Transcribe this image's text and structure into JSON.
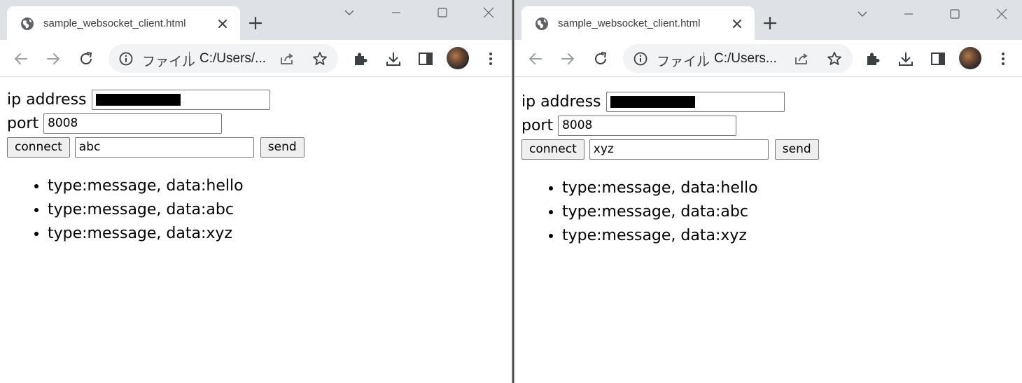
{
  "windows": [
    {
      "tab_title": "sample_websocket_client.html",
      "omnibox": {
        "scheme_label": "ファイル",
        "url": "C:/Users/..."
      },
      "form": {
        "ip_label": "ip address",
        "ip_value": "",
        "port_label": "port",
        "port_value": "8008",
        "connect_label": "connect",
        "message_value": "abc",
        "send_label": "send"
      },
      "messages": [
        "type:message, data:hello",
        "type:message, data:abc",
        "type:message, data:xyz"
      ]
    },
    {
      "tab_title": "sample_websocket_client.html",
      "omnibox": {
        "scheme_label": "ファイル",
        "url": "C:/Users..."
      },
      "form": {
        "ip_label": "ip address",
        "ip_value": "",
        "port_label": "port",
        "port_value": "8008",
        "connect_label": "connect",
        "message_value": "xyz",
        "send_label": "send"
      },
      "messages": [
        "type:message, data:hello",
        "type:message, data:abc",
        "type:message, data:xyz"
      ]
    }
  ],
  "icons": {
    "tab": [
      "globe-icon",
      "close-icon",
      "new-tab-icon"
    ],
    "window_controls": [
      "tab-search-icon",
      "minimize-icon",
      "maximize-icon",
      "window-close-icon"
    ],
    "toolbar": [
      "back-arrow-icon",
      "forward-arrow-icon",
      "reload-icon",
      "info-icon",
      "share-icon",
      "star-icon",
      "extensions-icon",
      "download-icon",
      "side-panel-icon",
      "avatar",
      "menu-icon"
    ]
  },
  "colors": {
    "titlebar": "#dee1e6",
    "tab_active": "#ffffff",
    "omnibox_bg": "#f1f3f4",
    "icon": "#5f6368",
    "icon_disabled": "#9aa0a6",
    "masked_ip": "#000000"
  }
}
